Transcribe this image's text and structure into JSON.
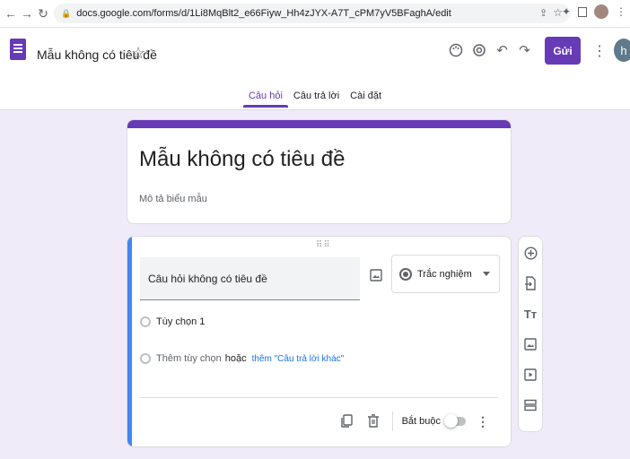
{
  "browser": {
    "url": "docs.google.com/forms/d/1Li8MqBlt2_e66Fiyw_Hh4zJYX-A7T_cPM7yV5BFaghA/edit"
  },
  "header": {
    "doc_title": "Mẫu không có tiêu đề",
    "send_label": "Gửi",
    "avatar_letter": "h",
    "accent_color": "#673ab7"
  },
  "tabs": [
    {
      "label": "Câu hỏi",
      "active": true
    },
    {
      "label": "Câu trả lời",
      "active": false
    },
    {
      "label": "Cài đặt",
      "active": false
    }
  ],
  "title_card": {
    "title": "Mẫu không có tiêu đề",
    "description": "Mô tả biểu mẫu"
  },
  "question": {
    "title": "Câu hỏi không có tiêu đề",
    "type": "Trắc nghiệm",
    "options": [
      {
        "label": "Tùy chọn 1"
      }
    ],
    "add_option": "Thêm tùy chọn",
    "or": "hoặc",
    "add_other": "thêm \"Câu trả lời khác\"",
    "required_label": "Bắt buộc",
    "required": false
  }
}
